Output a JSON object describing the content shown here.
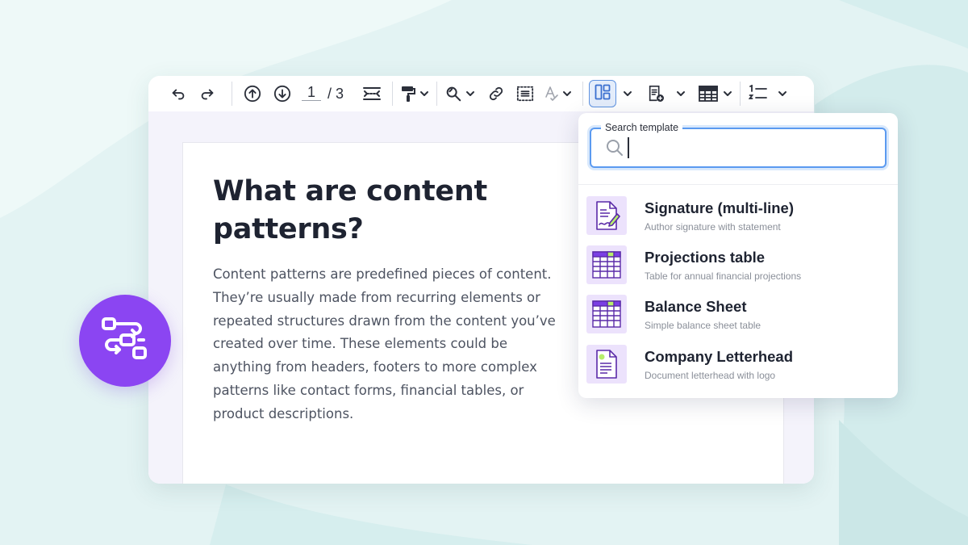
{
  "toolbar": {
    "undo_icon": "undo-icon",
    "redo_icon": "redo-icon",
    "prev_page_icon": "arrow-up-circle-icon",
    "next_page_icon": "arrow-down-circle-icon",
    "current_page": "1",
    "total_pages": "/ 3",
    "page_break_icon": "page-break-icon",
    "format_painter_icon": "paint-roller-icon",
    "find_replace_icon": "find-replace-icon",
    "link_icon": "link-icon",
    "select_all_icon": "select-all-icon",
    "spellcheck_icon": "spellcheck-icon",
    "templates_icon": "layout-template-icon",
    "insert_doc_icon": "insert-document-icon",
    "table_icon": "table-icon",
    "numbered_list_icon": "numbered-list-icon"
  },
  "document": {
    "heading": "What are content patterns?",
    "body": "Content patterns are predefined pieces of content. They’re usually made from recurring elements or repeated structures  drawn from the content you’ve created over time. These elements could be anything from headers, footers to more complex patterns like contact forms, financial tables, or product descriptions."
  },
  "badge": {
    "icon": "workflow-icon"
  },
  "template_search": {
    "label": "Search template",
    "value": ""
  },
  "templates": [
    {
      "title": "Signature (multi-line)",
      "description": "Author signature with statement",
      "icon": "signature-doc-icon"
    },
    {
      "title": "Projections table",
      "description": "Table for annual financial projections",
      "icon": "table-thumb-icon"
    },
    {
      "title": "Balance Sheet",
      "description": "Simple balance sheet table",
      "icon": "table-thumb-icon"
    },
    {
      "title": "Company Letterhead",
      "description": "Document letterhead with logo",
      "icon": "letterhead-doc-icon"
    }
  ],
  "colors": {
    "accent_purple": "#8b45f2",
    "thumb_bg": "#ece2fc",
    "thumb_green": "#b7ef6b",
    "focus_blue": "#5b9af0",
    "background": "#e3f3f3"
  }
}
